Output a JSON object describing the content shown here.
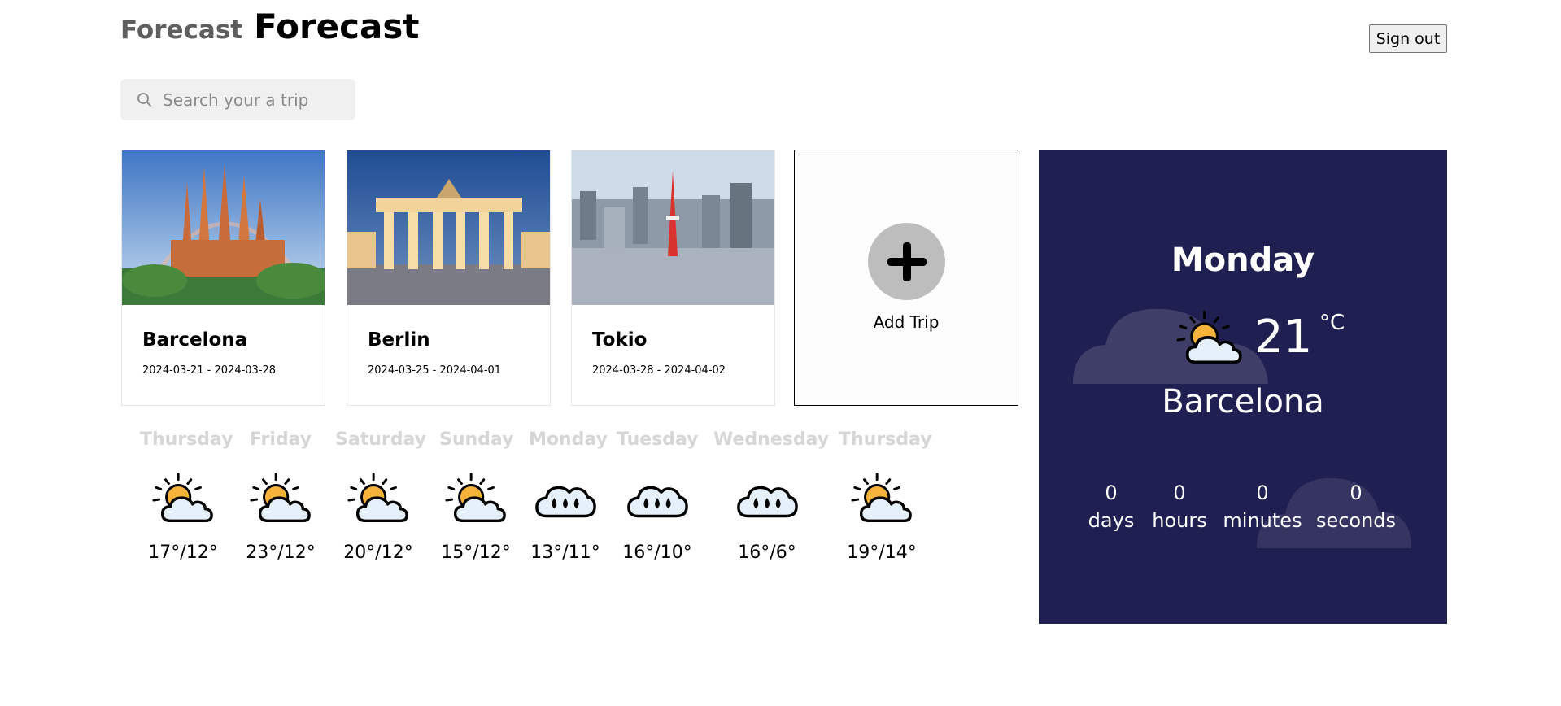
{
  "header": {
    "title_light": "Forecast",
    "title_bold": "Forecast",
    "signout_label": "Sign out"
  },
  "search": {
    "placeholder": "Search your a trip",
    "value": ""
  },
  "trips": [
    {
      "name": "Barcelona",
      "dates": "2024-03-21 - 2024-03-28",
      "image": "sagrada-familia-photo"
    },
    {
      "name": "Berlin",
      "dates": "2024-03-25 - 2024-04-01",
      "image": "brandenburg-gate-photo"
    },
    {
      "name": "Tokio",
      "dates": "2024-03-28 - 2024-04-02",
      "image": "tokyo-tower-skyline-photo"
    }
  ],
  "add_trip": {
    "label": "Add Trip"
  },
  "forecast": [
    {
      "day": "Thursday",
      "temps": "17°/12°",
      "icon": "partly-sunny-icon"
    },
    {
      "day": "Friday",
      "temps": "23°/12°",
      "icon": "partly-sunny-icon"
    },
    {
      "day": "Saturday",
      "temps": "20°/12°",
      "icon": "partly-sunny-icon"
    },
    {
      "day": "Sunday",
      "temps": "15°/12°",
      "icon": "partly-sunny-icon"
    },
    {
      "day": "Monday",
      "temps": "13°/11°",
      "icon": "rain-cloud-icon"
    },
    {
      "day": "Tuesday",
      "temps": "16°/10°",
      "icon": "rain-cloud-icon"
    },
    {
      "day": "Wednesday",
      "temps": "16°/6°",
      "icon": "rain-cloud-icon"
    },
    {
      "day": "Thursday",
      "temps": "19°/14°",
      "icon": "partly-sunny-icon"
    }
  ],
  "today": {
    "day": "Monday",
    "temp": "21",
    "unit": "°C",
    "city": "Barcelona",
    "icon": "partly-sunny-icon",
    "countdown": [
      {
        "value": "0",
        "label": "days"
      },
      {
        "value": "0",
        "label": "hours"
      },
      {
        "value": "0",
        "label": "minutes"
      },
      {
        "value": "0",
        "label": "seconds"
      }
    ]
  },
  "colors": {
    "panel_bg": "#201f51",
    "sun": "#f5b33b",
    "cloud": "#e6f0fb",
    "add_circle": "#bdbdbd",
    "day_name": "#d6d6d6"
  }
}
